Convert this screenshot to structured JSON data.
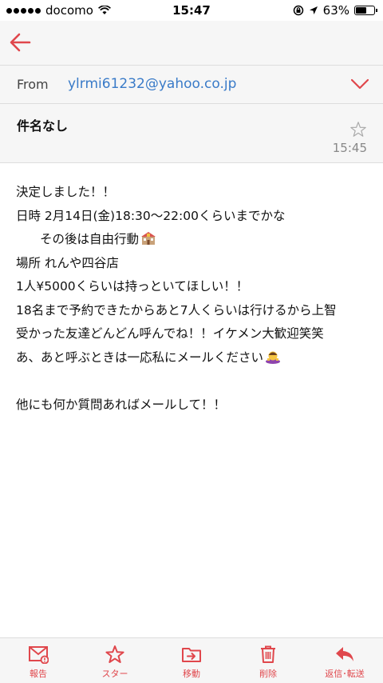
{
  "status_bar": {
    "carrier": "docomo",
    "time": "15:47",
    "battery_percent": "63%",
    "battery_level": 0.63
  },
  "header": {
    "back_icon": "back-arrow-icon"
  },
  "from": {
    "label": "From",
    "address": "ylrmi61232@yahoo.co.jp"
  },
  "subject": {
    "title": "件名なし",
    "time": "15:45",
    "starred": false
  },
  "body": {
    "lines": [
      "決定しました！！",
      "日時 2月14日(金)18:30〜22:00くらいまでかな",
      "その後は自由行動",
      "場所 れんや四谷店",
      "1人¥5000くらいは持っといてほしい！！",
      "18名まで予約できたからあと7人くらいは行けるから上智",
      "受かった友達どんどん呼んでね！！イケメン大歓迎笑笑",
      "あ、あと呼ぶときは一応私にメールください",
      "他にも何か質問あればメールして！！"
    ]
  },
  "toolbar": {
    "report": "報告",
    "star": "スター",
    "move": "移動",
    "delete": "削除",
    "reply": "返信･転送"
  },
  "colors": {
    "accent": "#e0474c",
    "link": "#3a7bc8",
    "bar_bg": "#f6f6f6"
  }
}
